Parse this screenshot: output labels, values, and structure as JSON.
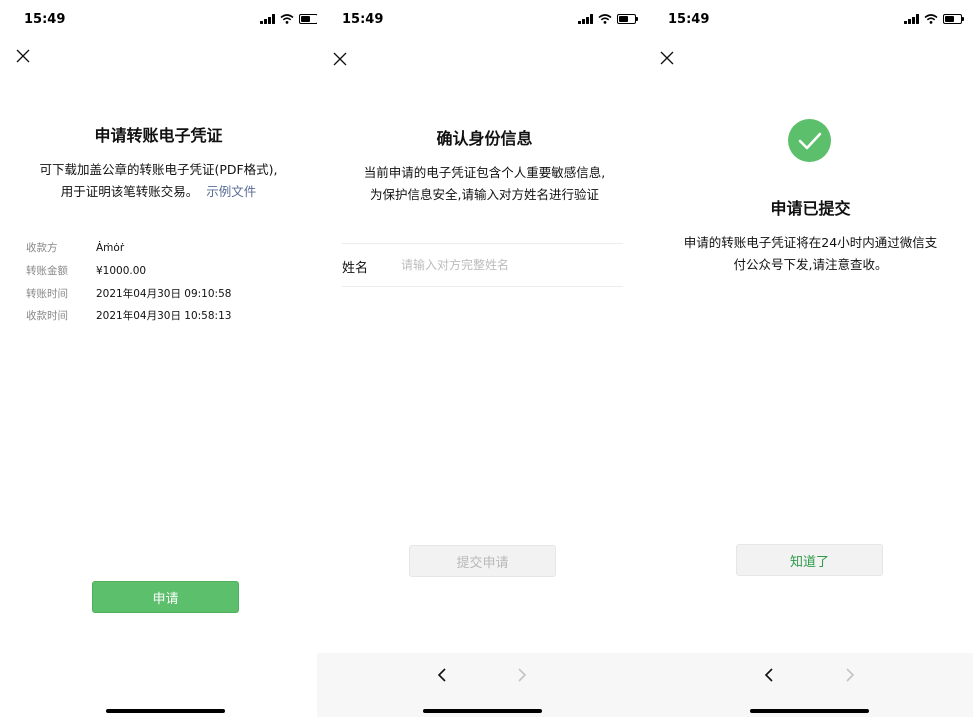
{
  "status_bar": {
    "time": "15:49"
  },
  "panel1": {
    "title": "申请转账电子凭证",
    "desc_line1": "可下载加盖公章的转账电子凭证(PDF格式),",
    "desc_line2": "用于证明该笔转账交易。",
    "sample_link": "示例文件",
    "rows": [
      {
        "label": "收款方",
        "value": "Ȧṁȯṙ"
      },
      {
        "label": "转账金额",
        "value": "¥1000.00"
      },
      {
        "label": "转账时间",
        "value": "2021年04月30日 09:10:58"
      },
      {
        "label": "收款时间",
        "value": "2021年04月30日 10:58:13"
      }
    ],
    "apply_button": "申请"
  },
  "panel2": {
    "title": "确认身份信息",
    "desc_line1": "当前申请的电子凭证包含个人重要敏感信息,",
    "desc_line2": "为保护信息安全,请输入对方姓名进行验证",
    "name_label": "姓名",
    "name_value": "",
    "name_placeholder": "请输入对方完整姓名",
    "submit_button": "提交申请"
  },
  "panel3": {
    "title": "申请已提交",
    "desc_line1": "申请的转账电子凭证将在24小时内通过微信支",
    "desc_line2": "付公众号下发,请注意查收。",
    "ok_button": "知道了"
  },
  "icons": {
    "close": "close-icon",
    "back": "chevron-left-icon",
    "forward": "chevron-right-icon",
    "success": "check-circle-icon"
  },
  "colors": {
    "primary_green": "#5cbf6b",
    "link_blue": "#576b95",
    "ok_text_green": "#2c9a48"
  }
}
